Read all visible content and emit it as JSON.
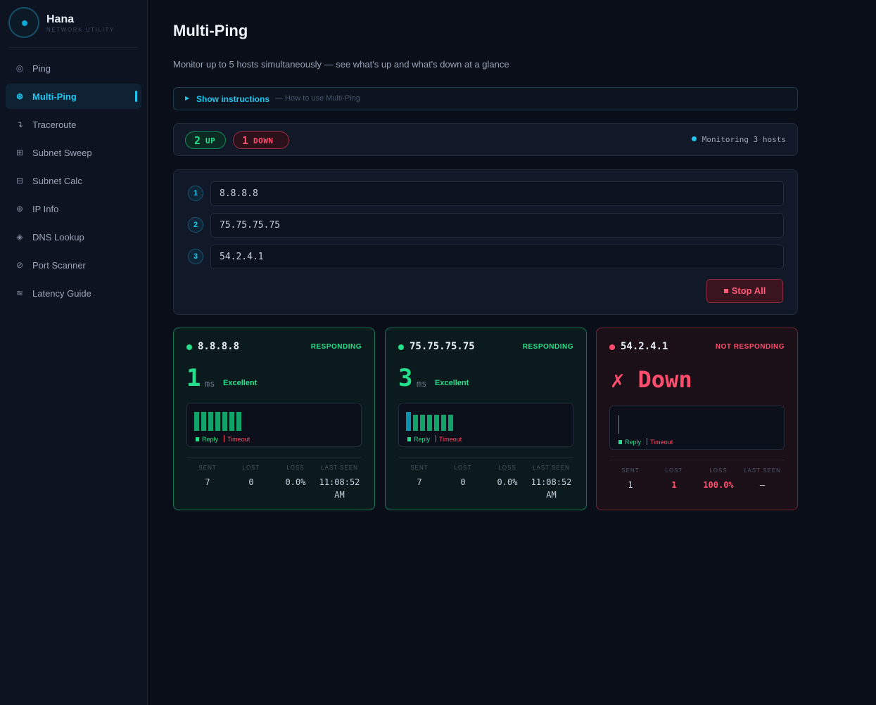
{
  "brand": {
    "name": "Hana",
    "subtitle": "NETWORK UTILITY"
  },
  "sidebar": {
    "items": [
      {
        "label": "Ping",
        "icon": "ping-icon",
        "glyph": "◎"
      },
      {
        "label": "Multi-Ping",
        "icon": "multi-ping-icon",
        "glyph": "⊛",
        "active": true
      },
      {
        "label": "Traceroute",
        "icon": "traceroute-icon",
        "glyph": "↴"
      },
      {
        "label": "Subnet Sweep",
        "icon": "subnet-sweep-icon",
        "glyph": "⊞"
      },
      {
        "label": "Subnet Calc",
        "icon": "subnet-calc-icon",
        "glyph": "⊟"
      },
      {
        "label": "IP Info",
        "icon": "ip-info-icon",
        "glyph": "⊕"
      },
      {
        "label": "DNS Lookup",
        "icon": "dns-lookup-icon",
        "glyph": "◈"
      },
      {
        "label": "Port Scanner",
        "icon": "port-scanner-icon",
        "glyph": "⊘"
      },
      {
        "label": "Latency Guide",
        "icon": "latency-guide-icon",
        "glyph": "≋"
      }
    ]
  },
  "page": {
    "title": "Multi-Ping",
    "subtitle": "Monitor up to 5 hosts simultaneously — see what's up and what's down at a glance"
  },
  "instructions": {
    "label": "Show instructions",
    "hint": "— How to use Multi-Ping"
  },
  "summary": {
    "up_count": "2",
    "up_label": "UP",
    "down_count": "1",
    "down_label": "DOWN",
    "monitoring": "Monitoring 3 hosts"
  },
  "hosts": [
    {
      "index": "1",
      "value": "8.8.8.8"
    },
    {
      "index": "2",
      "value": "75.75.75.75"
    },
    {
      "index": "3",
      "value": "54.2.4.1"
    }
  ],
  "stop_button": {
    "label": "Stop All"
  },
  "legend": {
    "reply": "Reply",
    "timeout": "Timeout"
  },
  "stat_labels": {
    "sent": "SENT",
    "lost": "LOST",
    "loss": "LOSS",
    "last_seen": "LAST SEEN"
  },
  "cards": [
    {
      "host": "8.8.8.8",
      "status": "RESPONDING",
      "latency": "1",
      "unit": "ms",
      "quality": "Excellent",
      "bars": [
        1,
        1,
        1,
        1,
        1,
        1,
        1
      ],
      "sent": "7",
      "lost": "0",
      "loss": "0.0%",
      "last_seen": "11:08:52 AM"
    },
    {
      "host": "75.75.75.75",
      "status": "RESPONDING",
      "latency": "3",
      "unit": "ms",
      "quality": "Excellent",
      "bars": [
        3,
        2,
        2,
        2,
        2,
        2,
        2
      ],
      "sent": "7",
      "lost": "0",
      "loss": "0.0%",
      "last_seen": "11:08:52 AM"
    },
    {
      "host": "54.2.4.1",
      "status": "NOT RESPONDING",
      "down_text": "✗ Down",
      "timeouts": 1,
      "sent": "1",
      "lost": "1",
      "loss": "100.0%",
      "last_seen": "—"
    }
  ],
  "colors": {
    "accent": "#1fc6ef",
    "up": "#22e08b",
    "down": "#ff4d6d"
  }
}
